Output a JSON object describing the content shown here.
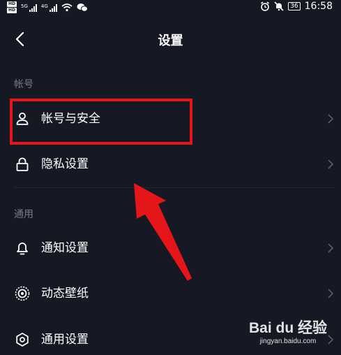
{
  "status_bar": {
    "hd1": "HD",
    "hd2": "HD",
    "signal1_label": "5G",
    "signal2_label": "4G",
    "battery": "36",
    "time": "16:58"
  },
  "header": {
    "title": "设置"
  },
  "sections": [
    {
      "title": "帐号",
      "items": [
        {
          "label": "帐号与安全",
          "icon": "person-icon"
        },
        {
          "label": "隐私设置",
          "icon": "lock-icon"
        }
      ]
    },
    {
      "title": "通用",
      "items": [
        {
          "label": "通知设置",
          "icon": "bell-icon"
        },
        {
          "label": "动态壁纸",
          "icon": "live-wallpaper-icon"
        },
        {
          "label": "通用设置",
          "icon": "gear-icon"
        }
      ]
    }
  ],
  "annotation": {
    "highlight_color": "#e5161a"
  },
  "watermark": {
    "logo": "Bai du 经验",
    "url": "jingyan.baidu.com"
  },
  "colors": {
    "background": "#161823",
    "section_title": "#7a7c86",
    "chevron": "#5a5c66"
  }
}
